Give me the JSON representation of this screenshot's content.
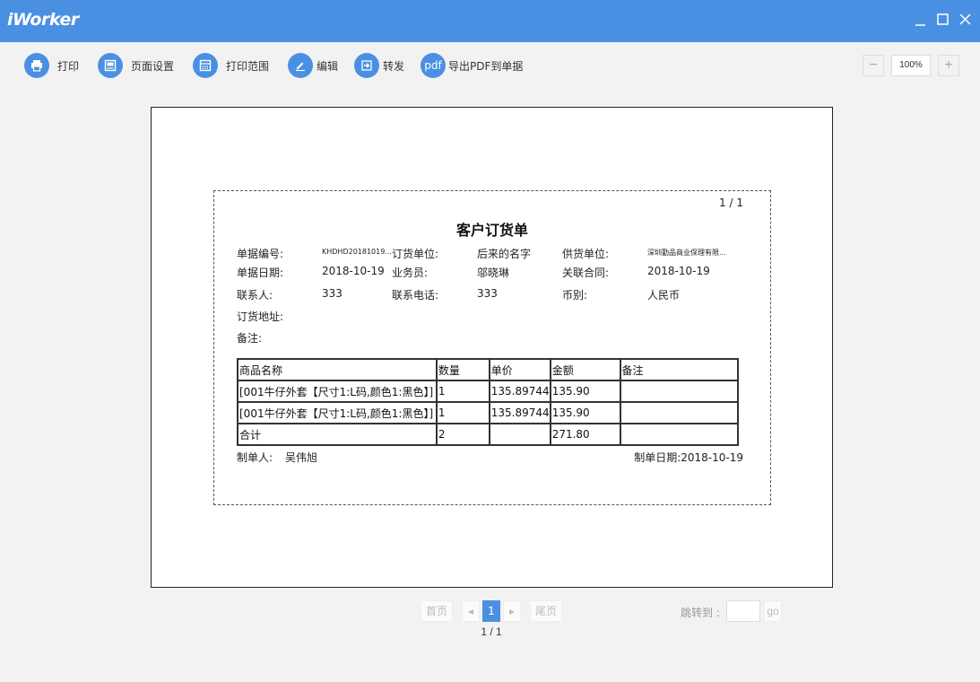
{
  "app": {
    "title": "iWorker",
    "minimize_icon": "minimize-icon",
    "maximize_icon": "maximize-icon",
    "close_icon": "close-icon"
  },
  "toolbar": {
    "items": [
      {
        "label": "打印",
        "icon": "printer-icon"
      },
      {
        "label": "页面设置",
        "icon": "page-setup-icon"
      },
      {
        "label": "打印范围",
        "icon": "print-range-icon"
      },
      {
        "label": "编辑",
        "icon": "edit-pen-icon"
      },
      {
        "label": "转发",
        "icon": "forward-icon"
      },
      {
        "label": "导出PDF到单据",
        "icon": "pdf-icon",
        "icon_text": "pdf"
      }
    ],
    "zoom": {
      "minus": "−",
      "value": "100%",
      "plus": "+"
    }
  },
  "document": {
    "page_counter": "1 / 1",
    "title": "客户订货单",
    "fields": {
      "doc_no_label": "单据编号:",
      "doc_no_value": "KHDHD20181019...",
      "order_unit_label": "订货单位:",
      "order_unit_value": "后来的名字",
      "supplier_label": "供货单位:",
      "supplier_value": "深圳勤品商业保理有限...",
      "doc_date_label": "单据日期:",
      "doc_date_value": "2018-10-19",
      "salesman_label": "业务员:",
      "salesman_value": "邬晓琳",
      "contract_label": "关联合同:",
      "contract_value": "2018-10-19",
      "contact_label": "联系人:",
      "contact_value": "333",
      "phone_label": "联系电话:",
      "phone_value": "333",
      "currency_label": "币别:",
      "currency_value": "人民币",
      "address_label": "订货地址:",
      "remark_label": "备注:"
    },
    "table": {
      "headers": [
        "商品名称",
        "数量",
        "单价",
        "金额",
        "备注"
      ],
      "rows": [
        [
          "[001牛仔外套【尺寸1:L码,颜色1:黑色】]",
          "1",
          "135.89744",
          "135.90",
          ""
        ],
        [
          "[001牛仔外套【尺寸1:L码,颜色1:黑色】]",
          "1",
          "135.89744",
          "135.90",
          ""
        ],
        [
          "合计",
          "2",
          "",
          "271.80",
          ""
        ]
      ]
    },
    "footer": {
      "maker_label": "制单人:",
      "maker_value": "吴伟旭",
      "date_label": "制单日期:",
      "date_value": "2018-10-19"
    }
  },
  "pager": {
    "first": "首页",
    "prev": "◂",
    "current": "1",
    "next": "▸",
    "last": "尾页",
    "info": "1 / 1",
    "jump_label": "跳转到 :",
    "go": "go"
  },
  "colors": {
    "accent": "#4a90e2"
  }
}
